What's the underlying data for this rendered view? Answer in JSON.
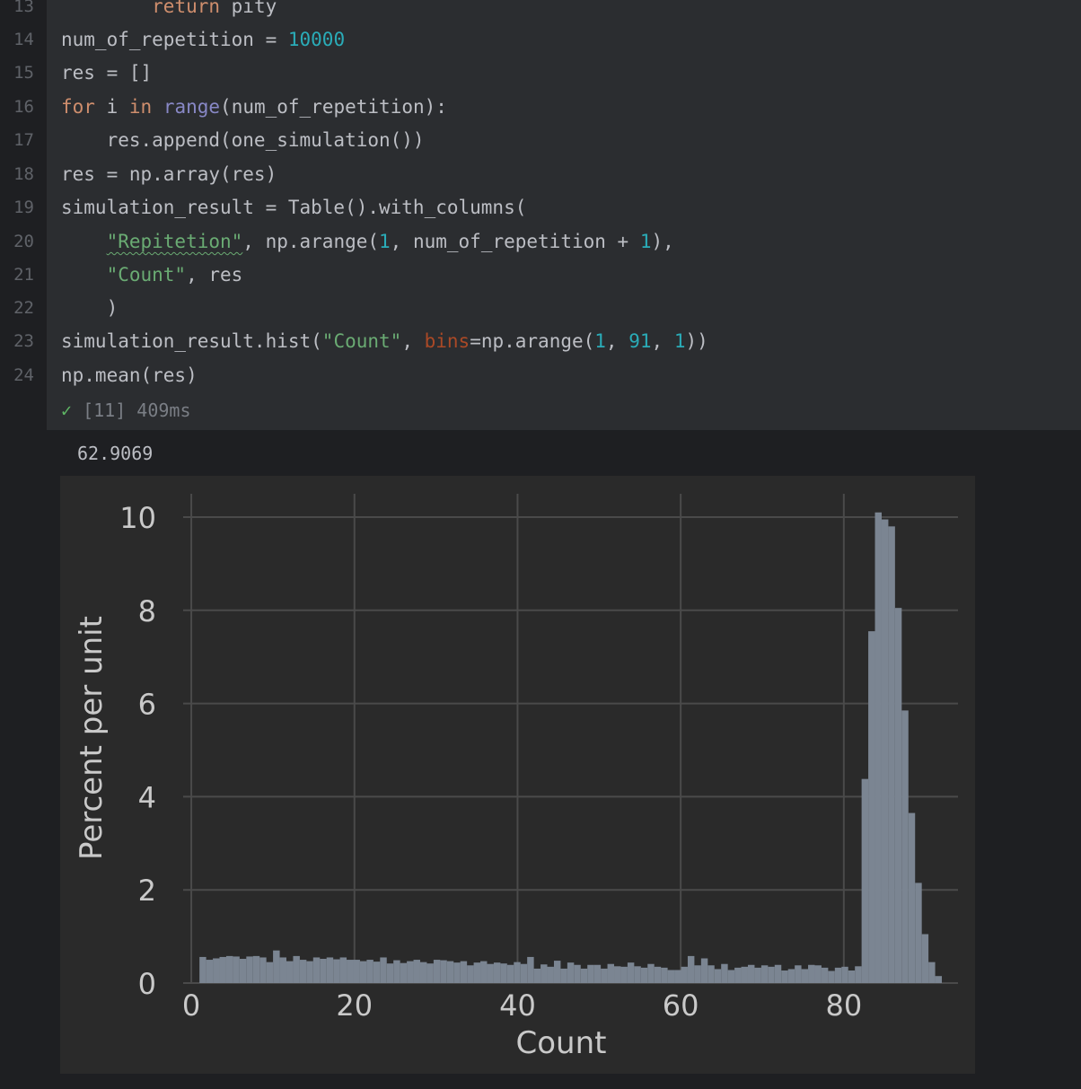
{
  "editor": {
    "lines": [
      {
        "num": "13",
        "tokens": [
          {
            "t": "        "
          },
          {
            "t": "return",
            "c": "kw"
          },
          {
            "t": " pity"
          }
        ]
      },
      {
        "num": "14",
        "tokens": [
          {
            "t": "num_of_repetition = "
          },
          {
            "t": "10000",
            "c": "num"
          }
        ]
      },
      {
        "num": "15",
        "tokens": [
          {
            "t": "res = []"
          }
        ]
      },
      {
        "num": "16",
        "tokens": [
          {
            "t": "for",
            "c": "kw"
          },
          {
            "t": " i "
          },
          {
            "t": "in",
            "c": "kw"
          },
          {
            "t": " "
          },
          {
            "t": "range",
            "c": "bi"
          },
          {
            "t": "(num_of_repetition):"
          }
        ]
      },
      {
        "num": "17",
        "tokens": [
          {
            "t": "    res.append(one_simulation())"
          }
        ]
      },
      {
        "num": "18",
        "tokens": [
          {
            "t": "res = np.array(res)"
          }
        ]
      },
      {
        "num": "19",
        "tokens": [
          {
            "t": "simulation_result = Table().with_columns("
          }
        ]
      },
      {
        "num": "20",
        "tokens": [
          {
            "t": "    "
          },
          {
            "t": "\"Repitetion\"",
            "c": "str squig"
          },
          {
            "t": ", np.arange("
          },
          {
            "t": "1",
            "c": "num"
          },
          {
            "t": ", num_of_repetition + "
          },
          {
            "t": "1",
            "c": "num"
          },
          {
            "t": "),"
          }
        ]
      },
      {
        "num": "21",
        "tokens": [
          {
            "t": "    "
          },
          {
            "t": "\"Count\"",
            "c": "str"
          },
          {
            "t": ", res"
          }
        ]
      },
      {
        "num": "22",
        "tokens": [
          {
            "t": "    )"
          }
        ]
      },
      {
        "num": "23",
        "tokens": [
          {
            "t": "simulation_result.hist("
          },
          {
            "t": "\"Count\"",
            "c": "str"
          },
          {
            "t": ", "
          },
          {
            "t": "bins",
            "c": "param"
          },
          {
            "t": "=np.arange("
          },
          {
            "t": "1",
            "c": "num"
          },
          {
            "t": ", "
          },
          {
            "t": "91",
            "c": "num"
          },
          {
            "t": ", "
          },
          {
            "t": "1",
            "c": "num"
          },
          {
            "t": "))"
          }
        ]
      },
      {
        "num": "24",
        "tokens": [
          {
            "t": "np.mean(res)"
          }
        ]
      }
    ]
  },
  "cell_status": {
    "check": "✓",
    "execution": "[11] 409ms"
  },
  "output": {
    "mean_value": "62.9069"
  },
  "colors": {
    "bar": "#7b8592",
    "grid": "#4a4a4a",
    "chart_bg": "#2a2a2a"
  },
  "chart_data": {
    "type": "bar",
    "xlabel": "Count",
    "ylabel": "Percent per unit",
    "xlim": [
      -1,
      94
    ],
    "ylim": [
      0,
      10.5
    ],
    "xticks": [
      0,
      20,
      40,
      60,
      80
    ],
    "yticks": [
      0,
      2,
      4,
      6,
      8,
      10
    ],
    "grid": true,
    "bin_start": 1,
    "bin_width": 1,
    "values": [
      0.56,
      0.5,
      0.53,
      0.56,
      0.58,
      0.57,
      0.52,
      0.57,
      0.58,
      0.55,
      0.45,
      0.7,
      0.55,
      0.47,
      0.58,
      0.5,
      0.47,
      0.55,
      0.52,
      0.55,
      0.51,
      0.55,
      0.5,
      0.5,
      0.47,
      0.5,
      0.46,
      0.55,
      0.42,
      0.49,
      0.43,
      0.47,
      0.5,
      0.45,
      0.42,
      0.5,
      0.49,
      0.47,
      0.44,
      0.47,
      0.38,
      0.44,
      0.47,
      0.41,
      0.44,
      0.42,
      0.39,
      0.45,
      0.41,
      0.56,
      0.31,
      0.4,
      0.35,
      0.48,
      0.31,
      0.44,
      0.39,
      0.31,
      0.39,
      0.39,
      0.31,
      0.41,
      0.36,
      0.35,
      0.44,
      0.36,
      0.33,
      0.41,
      0.35,
      0.33,
      0.28,
      0.28,
      0.35,
      0.58,
      0.38,
      0.53,
      0.38,
      0.3,
      0.41,
      0.28,
      0.33,
      0.35,
      0.39,
      0.33,
      0.38,
      0.35,
      0.39,
      0.27,
      0.3,
      0.38,
      0.3,
      0.39,
      0.38,
      0.33,
      0.26,
      0.33,
      0.35,
      0.27,
      0.36,
      4.38,
      7.55,
      10.1,
      9.95,
      9.8,
      8.05,
      5.85,
      3.65,
      2.15,
      1.05,
      0.45,
      0.15
    ]
  }
}
